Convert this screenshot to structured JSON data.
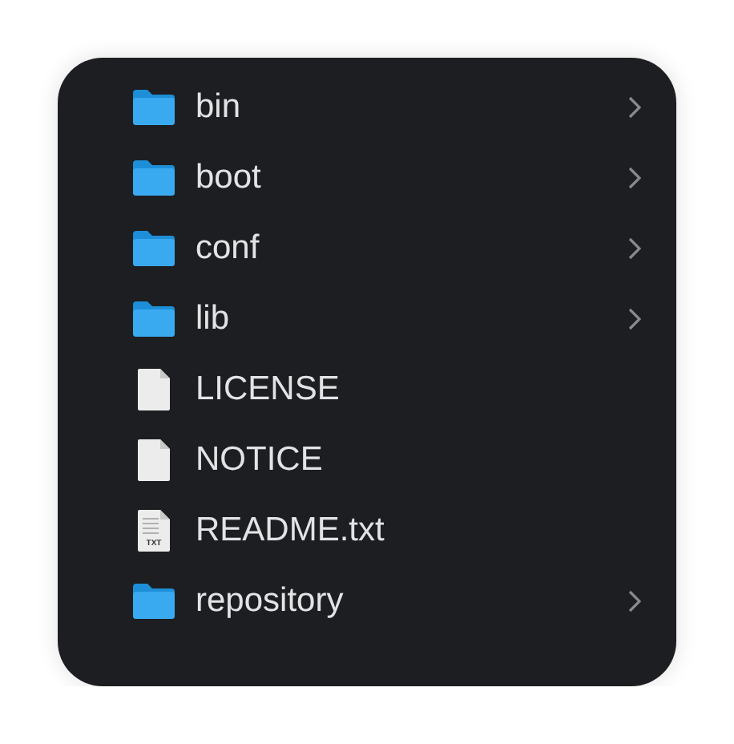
{
  "items": [
    {
      "name": "bin",
      "kind": "folder",
      "has_children": true
    },
    {
      "name": "boot",
      "kind": "folder",
      "has_children": true
    },
    {
      "name": "conf",
      "kind": "folder",
      "has_children": true
    },
    {
      "name": "lib",
      "kind": "folder",
      "has_children": true
    },
    {
      "name": "LICENSE",
      "kind": "file",
      "has_children": false
    },
    {
      "name": "NOTICE",
      "kind": "file",
      "has_children": false
    },
    {
      "name": "README.txt",
      "kind": "text",
      "badge": "TXT",
      "has_children": false
    },
    {
      "name": "repository",
      "kind": "folder",
      "has_children": true
    }
  ]
}
